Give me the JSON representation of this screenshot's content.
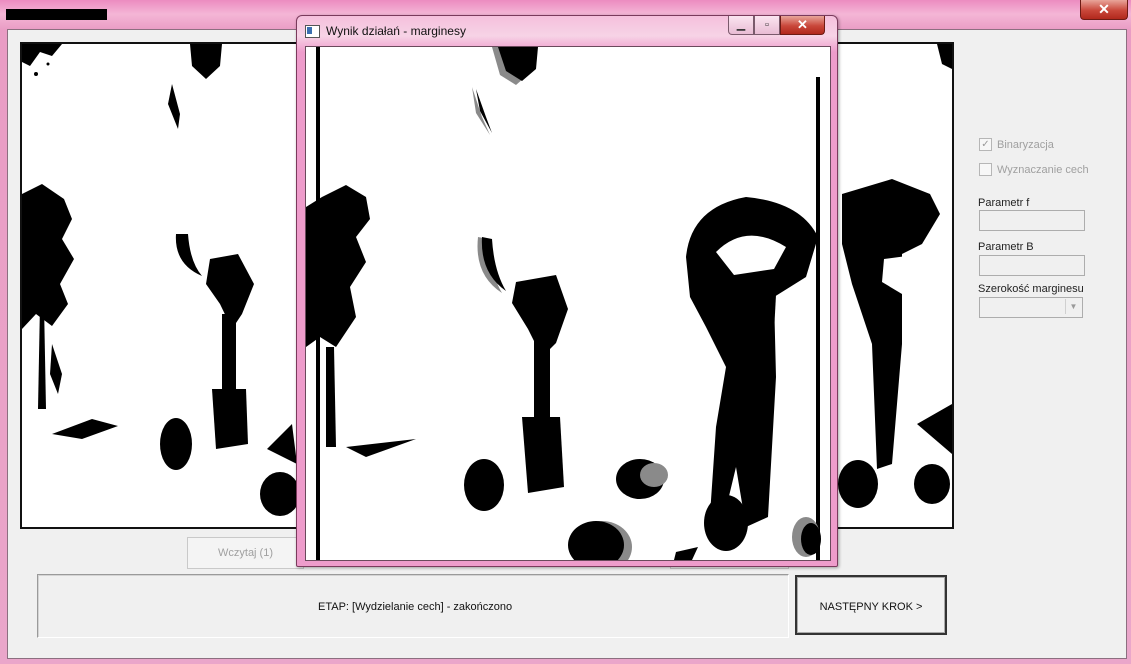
{
  "main_window": {
    "close_glyph": "✕"
  },
  "controls": {
    "binarization": {
      "label": "Binaryzacja",
      "checked": true,
      "enabled": false
    },
    "features": {
      "label": "Wyznaczanie cech",
      "checked": false,
      "enabled": false
    },
    "param_f": {
      "label": "Parametr f",
      "value": ""
    },
    "param_b": {
      "label": "Parametr B",
      "value": ""
    },
    "margin_width": {
      "label": "Szerokość marginesu",
      "value": ""
    }
  },
  "buttons": {
    "load": "Wczytaj (1)",
    "next": "NASTĘPNY KROK >"
  },
  "status": {
    "text": "ETAP: [Wydzielanie cech] - zakończono"
  },
  "dialog": {
    "title": "Wynik działań - marginesy",
    "minimize_glyph": "▁",
    "maximize_glyph": "▫",
    "close_glyph": "✕"
  },
  "icons": {
    "check": "✓",
    "dropdown_arrow": "▼"
  },
  "colors": {
    "window_frame": "#ec8cc0",
    "close_button": "#c9473a",
    "client_bg": "#f0f0f0",
    "image_ink": "#000000",
    "margin_gray": "#8a8a8a"
  }
}
